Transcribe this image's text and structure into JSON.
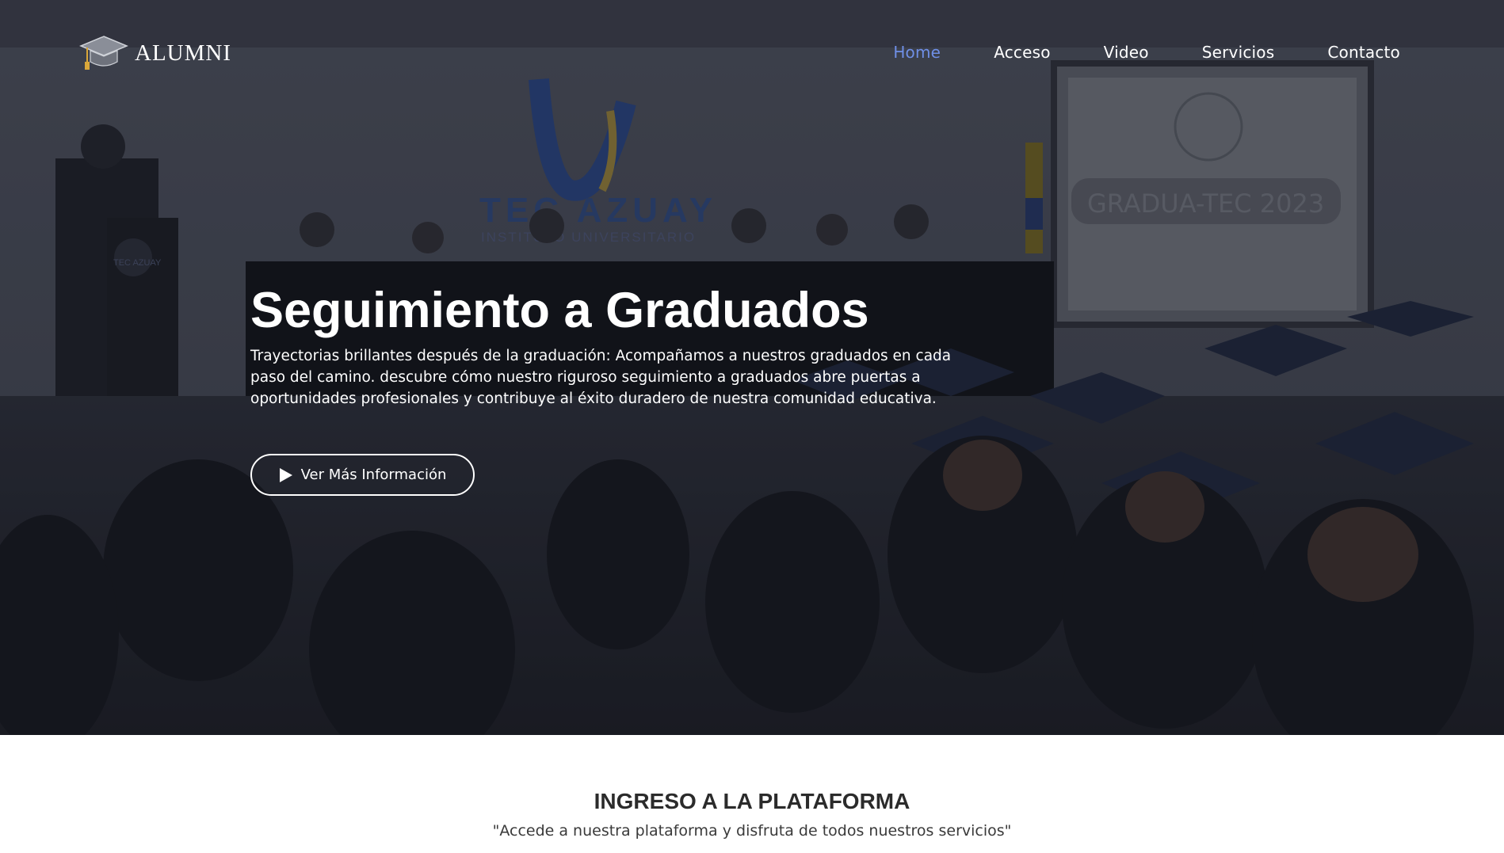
{
  "brand": {
    "name": "ALUMNI",
    "icon": "graduation-cap-icon"
  },
  "nav": {
    "items": [
      {
        "label": "Home",
        "active": true
      },
      {
        "label": "Acceso",
        "active": false
      },
      {
        "label": "Video",
        "active": false
      },
      {
        "label": "Servicios",
        "active": false
      },
      {
        "label": "Contacto",
        "active": false
      }
    ]
  },
  "hero": {
    "title": "Seguimiento a Graduados",
    "description": "Trayectorias brillantes después de la graduación: Acompañamos a nuestros graduados en cada paso del camino. descubre cómo nuestro riguroso seguimiento a graduados abre puertas a oportunidades profesionales y contribuye al éxito duradero de nuestra comunidad educativa.",
    "button_label": "Ver Más Información",
    "button_icon": "play-icon",
    "background_texts": {
      "wall_sign_main": "TEC AZUAY",
      "wall_sign_sub": "INSTITUTO UNIVERSITARIO",
      "screen_text": "GRADUA-TEC 2023",
      "podium_text": "TEC AZUAY"
    }
  },
  "section": {
    "title": "INGRESO A LA PLATAFORMA",
    "subtitle": "\"Accede a nuestra plataforma y disfruta de todos nuestros servicios\""
  },
  "colors": {
    "nav_active": "#6f8fe6",
    "hero_overlay": "#1e2130",
    "text_light": "#ffffff"
  }
}
